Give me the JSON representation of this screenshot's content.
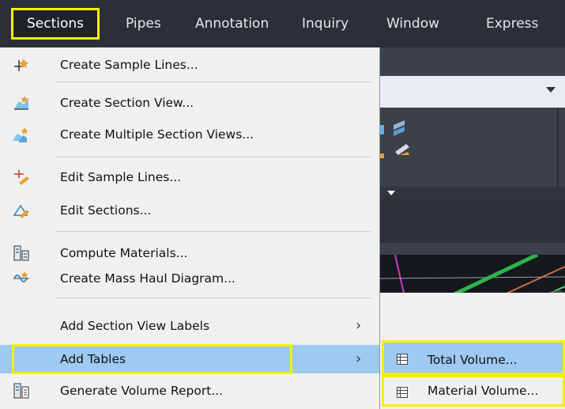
{
  "menubar": {
    "items": [
      "Sections",
      "Pipes",
      "Annotation",
      "Inquiry",
      "Window",
      "Express"
    ],
    "active": "Sections"
  },
  "sections_menu": {
    "items": [
      {
        "label": "Create Sample Lines...",
        "icon": "sample-lines-icon"
      },
      {
        "label": "Create Section View...",
        "icon": "section-view-icon"
      },
      {
        "label": "Create Multiple Section Views...",
        "icon": "multiple-section-views-icon"
      },
      {
        "label": "Edit Sample Lines...",
        "icon": "edit-sample-lines-icon"
      },
      {
        "label": "Edit Sections...",
        "icon": "edit-sections-icon"
      },
      {
        "label": "Compute Materials...",
        "icon": "compute-materials-icon"
      },
      {
        "label": "Create Mass Haul Diagram...",
        "icon": "mass-haul-icon"
      },
      {
        "label": "Add Section View Labels",
        "has_submenu": true
      },
      {
        "label": "Add Tables",
        "has_submenu": true,
        "highlighted": true
      },
      {
        "label": "Generate Volume Report...",
        "icon": "volume-report-icon"
      }
    ],
    "submenu_chevron": "›"
  },
  "add_tables_submenu": {
    "items": [
      {
        "label": "Total Volume...",
        "icon": "table-icon",
        "highlighted": true
      },
      {
        "label": "Material Volume...",
        "icon": "table-icon"
      }
    ]
  },
  "colors": {
    "highlight": "#9ec9f0",
    "callout": "#f4f000",
    "menubar": "#2b3038",
    "menu": "#f0f0f0"
  }
}
